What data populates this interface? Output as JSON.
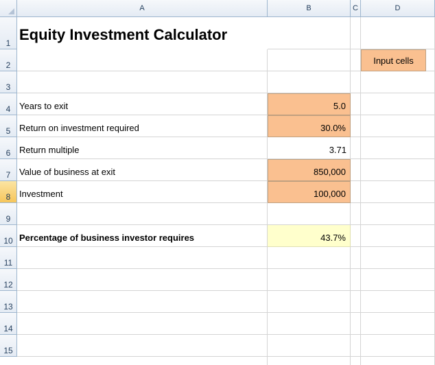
{
  "columns": [
    "A",
    "B",
    "C",
    "D"
  ],
  "rows": [
    "1",
    "2",
    "3",
    "4",
    "5",
    "6",
    "7",
    "8",
    "9",
    "10",
    "11",
    "12",
    "13",
    "14",
    "15"
  ],
  "title": "Equity Investment Calculator",
  "legend_label": "Input cells",
  "items": [
    {
      "label": "Years to exit",
      "value": "5.0",
      "input": true
    },
    {
      "label": "Return on investment required",
      "value": "30.0%",
      "input": true
    },
    {
      "label": "Return multiple",
      "value": "3.71",
      "input": false
    },
    {
      "label": "Value of business at exit",
      "value": "850,000",
      "input": true
    },
    {
      "label": "Investment",
      "value": "100,000",
      "input": true
    }
  ],
  "result": {
    "label": "Percentage of business investor requires",
    "value": "43.7%"
  },
  "selected_row": "8",
  "colors": {
    "input_fill": "#fac090",
    "result_fill": "#ffffcc",
    "header_fill": "#e4ebf4",
    "selected_header": "#f6c65b"
  }
}
